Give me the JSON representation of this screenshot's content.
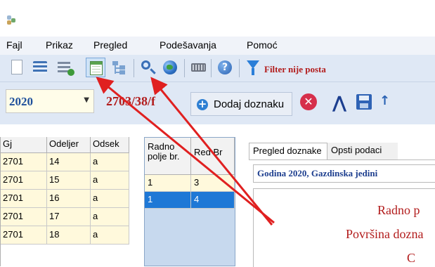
{
  "menu": [
    "Fajl",
    "Prikaz",
    "Pregled",
    "Podešavanja",
    "Pomoć"
  ],
  "toolbar": {
    "filter_text": "Filter nije posta",
    "icons": [
      "new-document-icon",
      "list-icon",
      "add-list-icon",
      "table-icon",
      "tree-icon",
      "search-icon",
      "globe-icon",
      "keyboard-icon",
      "help-icon",
      "filter-icon"
    ]
  },
  "toolbar2": {
    "year": "2020",
    "doc_code": "2703/38/f",
    "add_label": "Dodaj doznaku"
  },
  "grid": {
    "headers": [
      "Gj",
      "Odeljer",
      "Odsek"
    ],
    "rows": [
      [
        "2701",
        "14",
        "a"
      ],
      [
        "2701",
        "15",
        "a"
      ],
      [
        "2701",
        "16",
        "a"
      ],
      [
        "2701",
        "17",
        "a"
      ],
      [
        "2701",
        "18",
        "a"
      ]
    ]
  },
  "grid2": {
    "headers": [
      "Radno polje br.",
      "Red Br"
    ],
    "rows": [
      [
        "1",
        "3"
      ],
      [
        "1",
        "4"
      ]
    ]
  },
  "tabs": [
    "Pregled doznake",
    "Opsti podaci"
  ],
  "panel": {
    "info": "Godina 2020, Gazdinska jedini",
    "line1": "Radno p",
    "line2": "Površina dozna",
    "line3": "C"
  },
  "colors": {
    "accent_red": "#b21c1c",
    "selection_blue": "#1e78d6",
    "arrow_red": "#e02020"
  }
}
